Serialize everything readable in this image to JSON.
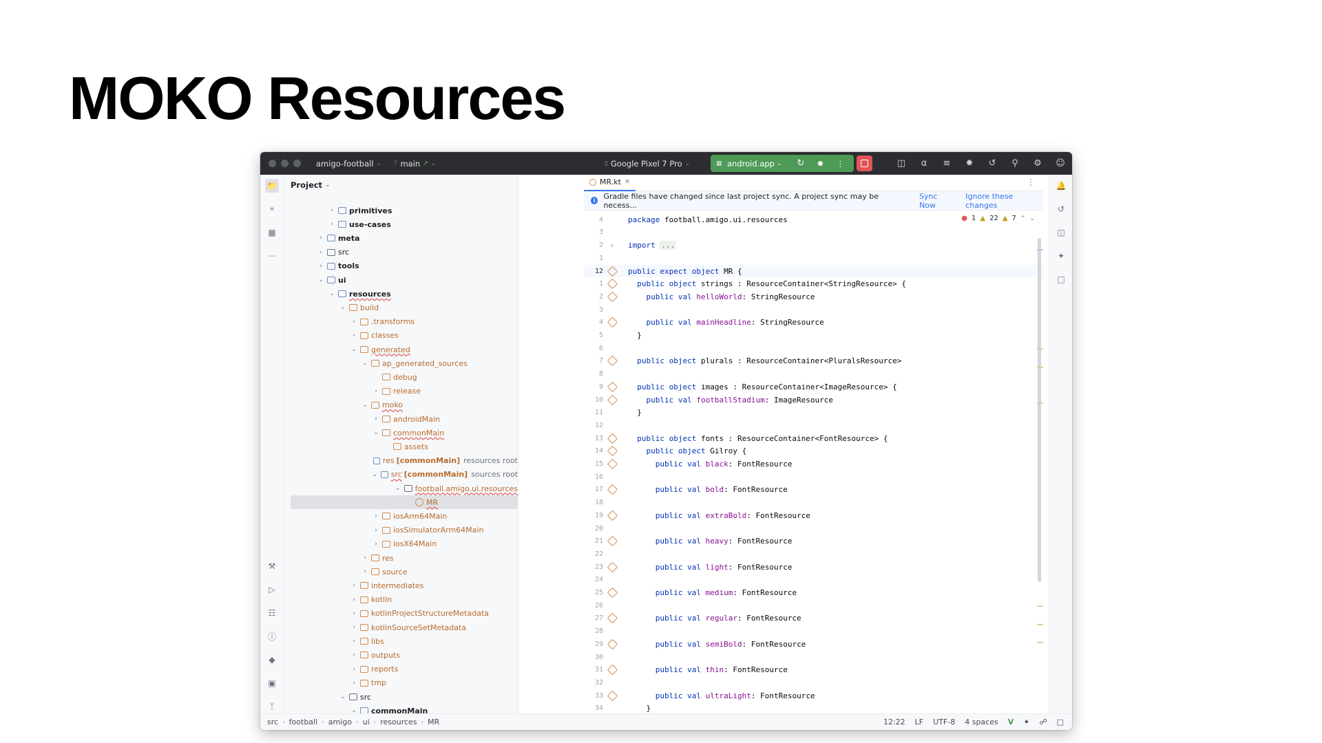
{
  "slide": {
    "title": "MOKO Resources"
  },
  "titlebar": {
    "project": "amigo-football",
    "branch": "main",
    "device": "Google Pixel 7 Pro",
    "run_config": "android.app"
  },
  "project_panel": {
    "title": "Project",
    "rows": [
      {
        "label": "primitives",
        "indent": 4,
        "chev": ">",
        "bold": true,
        "style": "blue"
      },
      {
        "label": "use-cases",
        "indent": 4,
        "chev": ">",
        "bold": true,
        "style": "blue"
      },
      {
        "label": "meta",
        "indent": 3,
        "chev": ">",
        "bold": true,
        "style": "blue"
      },
      {
        "label": "src",
        "indent": 3,
        "chev": ">",
        "bold": false,
        "style": "plain"
      },
      {
        "label": "tools",
        "indent": 3,
        "chev": ">",
        "bold": true,
        "style": "blue"
      },
      {
        "label": "ui",
        "indent": 3,
        "chev": "v",
        "bold": true,
        "style": "blue"
      },
      {
        "label": "resources",
        "indent": 4,
        "chev": "v",
        "bold": true,
        "style": "blue",
        "underline": true
      },
      {
        "label": "build",
        "indent": 5,
        "chev": "v",
        "style": "orange",
        "orangeText": true
      },
      {
        "label": ".transforms",
        "indent": 6,
        "chev": ">",
        "style": "orange",
        "orangeText": true
      },
      {
        "label": "classes",
        "indent": 6,
        "chev": ">",
        "style": "orange",
        "orangeText": true
      },
      {
        "label": "generated",
        "indent": 6,
        "chev": "v",
        "style": "orange",
        "orangeText": true,
        "underline": true
      },
      {
        "label": "ap_generated_sources",
        "indent": 7,
        "chev": "v",
        "style": "orange",
        "orangeText": true
      },
      {
        "label": "debug",
        "indent": 8,
        "chev": "",
        "style": "orange",
        "orangeText": true
      },
      {
        "label": "release",
        "indent": 8,
        "chev": ">",
        "style": "orange",
        "orangeText": true
      },
      {
        "label": "moko",
        "indent": 7,
        "chev": "v",
        "style": "orange",
        "orangeText": true,
        "underline": true
      },
      {
        "label": "androidMain",
        "indent": 8,
        "chev": ">",
        "style": "orange",
        "orangeText": true
      },
      {
        "label": "commonMain",
        "indent": 8,
        "chev": "v",
        "style": "orange",
        "orangeText": true,
        "underline": true
      },
      {
        "label": "assets",
        "indent": 9,
        "chev": "",
        "style": "orange",
        "orangeText": true
      },
      {
        "label": "res",
        "indent": 9,
        "chev": "",
        "style": "blue",
        "orangeText": true,
        "bracket": "[commonMain]",
        "suffix": "resources root"
      },
      {
        "label": "src",
        "indent": 9,
        "chev": "v",
        "style": "blue",
        "orangeText": true,
        "underline": true,
        "bracket": "[commonMain]",
        "suffix": "sources root"
      },
      {
        "label": "football.amigo.ui.resources",
        "indent": 10,
        "chev": "v",
        "style": "plain",
        "orangeText": true,
        "underline": true
      },
      {
        "label": "MR",
        "indent": 11,
        "chev": "",
        "style": "kotlin",
        "orangeText": true,
        "underline": true,
        "selected": true
      },
      {
        "label": "iosArm64Main",
        "indent": 8,
        "chev": ">",
        "style": "orange",
        "orangeText": true
      },
      {
        "label": "iosSimulatorArm64Main",
        "indent": 8,
        "chev": ">",
        "style": "orange",
        "orangeText": true
      },
      {
        "label": "iosX64Main",
        "indent": 8,
        "chev": ">",
        "style": "orange",
        "orangeText": true
      },
      {
        "label": "res",
        "indent": 7,
        "chev": ">",
        "style": "orange",
        "orangeText": true
      },
      {
        "label": "source",
        "indent": 7,
        "chev": ">",
        "style": "orange",
        "orangeText": true
      },
      {
        "label": "intermediates",
        "indent": 6,
        "chev": ">",
        "style": "orange",
        "orangeText": true
      },
      {
        "label": "kotlin",
        "indent": 6,
        "chev": ">",
        "style": "orange",
        "orangeText": true
      },
      {
        "label": "kotlinProjectStructureMetadata",
        "indent": 6,
        "chev": ">",
        "style": "orange",
        "orangeText": true
      },
      {
        "label": "kotlinSourceSetMetadata",
        "indent": 6,
        "chev": ">",
        "style": "orange",
        "orangeText": true
      },
      {
        "label": "libs",
        "indent": 6,
        "chev": ">",
        "style": "orange",
        "orangeText": true
      },
      {
        "label": "outputs",
        "indent": 6,
        "chev": ">",
        "style": "orange",
        "orangeText": true
      },
      {
        "label": "reports",
        "indent": 6,
        "chev": ">",
        "style": "orange",
        "orangeText": true
      },
      {
        "label": "tmp",
        "indent": 6,
        "chev": ">",
        "style": "orange",
        "orangeText": true
      },
      {
        "label": "src",
        "indent": 5,
        "chev": "v",
        "style": "plain"
      },
      {
        "label": "commonMain",
        "indent": 6,
        "chev": "v",
        "bold": true,
        "style": "blue"
      }
    ]
  },
  "editor": {
    "tab": "MR.kt",
    "notification": {
      "text": "Gradle files have changed since last project sync. A project sync may be necess...",
      "sync": "Sync Now",
      "ignore": "Ignore these changes"
    },
    "inspections": {
      "errors": "1",
      "warnings": "22",
      "weak": "7"
    },
    "lines": [
      {
        "n": "4",
        "icon": false,
        "parts": [
          [
            "kw",
            "package "
          ],
          [
            "t",
            "football.amigo.ui.resources"
          ]
        ]
      },
      {
        "n": "3",
        "icon": false,
        "parts": []
      },
      {
        "n": "2",
        "icon": false,
        "fold": true,
        "parts": [
          [
            "kw",
            "import "
          ],
          [
            "c",
            "..."
          ]
        ]
      },
      {
        "n": "1",
        "icon": false,
        "parts": []
      },
      {
        "n": "12",
        "icon": true,
        "current": true,
        "parts": [
          [
            "kw",
            "public expect object "
          ],
          [
            "t",
            "MR {"
          ]
        ]
      },
      {
        "n": "1",
        "icon": true,
        "parts": [
          [
            "t",
            "  "
          ],
          [
            "kw",
            "public object "
          ],
          [
            "t",
            "strings : ResourceContainer<StringResource> {"
          ]
        ]
      },
      {
        "n": "2",
        "icon": true,
        "parts": [
          [
            "t",
            "    "
          ],
          [
            "kw",
            "public val "
          ],
          [
            "fn",
            "helloWorld"
          ],
          [
            "t",
            ": StringResource"
          ]
        ]
      },
      {
        "n": "3",
        "icon": false,
        "parts": []
      },
      {
        "n": "4",
        "icon": true,
        "parts": [
          [
            "t",
            "    "
          ],
          [
            "kw",
            "public val "
          ],
          [
            "fn",
            "mainHeadline"
          ],
          [
            "t",
            ": StringResource"
          ]
        ]
      },
      {
        "n": "5",
        "icon": false,
        "parts": [
          [
            "t",
            "  }"
          ]
        ]
      },
      {
        "n": "6",
        "icon": false,
        "parts": []
      },
      {
        "n": "7",
        "icon": true,
        "parts": [
          [
            "t",
            "  "
          ],
          [
            "kw",
            "public object "
          ],
          [
            "t",
            "plurals : ResourceContainer<PluralsResource>"
          ]
        ]
      },
      {
        "n": "8",
        "icon": false,
        "parts": []
      },
      {
        "n": "9",
        "icon": true,
        "parts": [
          [
            "t",
            "  "
          ],
          [
            "kw",
            "public object "
          ],
          [
            "t",
            "images : ResourceContainer<ImageResource> {"
          ]
        ]
      },
      {
        "n": "10",
        "icon": true,
        "parts": [
          [
            "t",
            "    "
          ],
          [
            "kw",
            "public val "
          ],
          [
            "fn",
            "footballStadium"
          ],
          [
            "t",
            ": ImageResource"
          ]
        ]
      },
      {
        "n": "11",
        "icon": false,
        "parts": [
          [
            "t",
            "  }"
          ]
        ]
      },
      {
        "n": "12",
        "icon": false,
        "parts": []
      },
      {
        "n": "13",
        "icon": true,
        "parts": [
          [
            "t",
            "  "
          ],
          [
            "kw",
            "public object "
          ],
          [
            "t",
            "fonts : ResourceContainer<FontResource> {"
          ]
        ]
      },
      {
        "n": "14",
        "icon": true,
        "parts": [
          [
            "t",
            "    "
          ],
          [
            "kw",
            "public object "
          ],
          [
            "t",
            "Gilroy {"
          ]
        ]
      },
      {
        "n": "15",
        "icon": true,
        "parts": [
          [
            "t",
            "      "
          ],
          [
            "kw",
            "public val "
          ],
          [
            "fn",
            "black"
          ],
          [
            "t",
            ": FontResource"
          ]
        ]
      },
      {
        "n": "16",
        "icon": false,
        "parts": []
      },
      {
        "n": "17",
        "icon": true,
        "parts": [
          [
            "t",
            "      "
          ],
          [
            "kw",
            "public val "
          ],
          [
            "fn",
            "bold"
          ],
          [
            "t",
            ": FontResource"
          ]
        ]
      },
      {
        "n": "18",
        "icon": false,
        "parts": []
      },
      {
        "n": "19",
        "icon": true,
        "parts": [
          [
            "t",
            "      "
          ],
          [
            "kw",
            "public val "
          ],
          [
            "fn",
            "extraBold"
          ],
          [
            "t",
            ": FontResource"
          ]
        ]
      },
      {
        "n": "20",
        "icon": false,
        "parts": []
      },
      {
        "n": "21",
        "icon": true,
        "parts": [
          [
            "t",
            "      "
          ],
          [
            "kw",
            "public val "
          ],
          [
            "fn",
            "heavy"
          ],
          [
            "t",
            ": FontResource"
          ]
        ]
      },
      {
        "n": "22",
        "icon": false,
        "parts": []
      },
      {
        "n": "23",
        "icon": true,
        "parts": [
          [
            "t",
            "      "
          ],
          [
            "kw",
            "public val "
          ],
          [
            "fn",
            "light"
          ],
          [
            "t",
            ": FontResource"
          ]
        ]
      },
      {
        "n": "24",
        "icon": false,
        "parts": []
      },
      {
        "n": "25",
        "icon": true,
        "parts": [
          [
            "t",
            "      "
          ],
          [
            "kw",
            "public val "
          ],
          [
            "fn",
            "medium"
          ],
          [
            "t",
            ": FontResource"
          ]
        ]
      },
      {
        "n": "26",
        "icon": false,
        "parts": []
      },
      {
        "n": "27",
        "icon": true,
        "parts": [
          [
            "t",
            "      "
          ],
          [
            "kw",
            "public val "
          ],
          [
            "fn",
            "regular"
          ],
          [
            "t",
            ": FontResource"
          ]
        ]
      },
      {
        "n": "28",
        "icon": false,
        "parts": []
      },
      {
        "n": "29",
        "icon": true,
        "parts": [
          [
            "t",
            "      "
          ],
          [
            "kw",
            "public val "
          ],
          [
            "fn",
            "semiBold"
          ],
          [
            "t",
            ": FontResource"
          ]
        ]
      },
      {
        "n": "30",
        "icon": false,
        "parts": []
      },
      {
        "n": "31",
        "icon": true,
        "parts": [
          [
            "t",
            "      "
          ],
          [
            "kw",
            "public val "
          ],
          [
            "fn",
            "thin"
          ],
          [
            "t",
            ": FontResource"
          ]
        ]
      },
      {
        "n": "32",
        "icon": false,
        "parts": []
      },
      {
        "n": "33",
        "icon": true,
        "parts": [
          [
            "t",
            "      "
          ],
          [
            "kw",
            "public val "
          ],
          [
            "fn",
            "ultraLight"
          ],
          [
            "t",
            ": FontResource"
          ]
        ]
      },
      {
        "n": "34",
        "icon": false,
        "parts": [
          [
            "t",
            "    }"
          ]
        ]
      }
    ]
  },
  "statusbar": {
    "breadcrumbs": [
      "src",
      "football",
      "amigo",
      "ui",
      "resources",
      "MR"
    ],
    "position": "12:22",
    "line_sep": "LF",
    "encoding": "UTF-8",
    "indent": "4 spaces"
  },
  "colors": {
    "run_green": "#4e9a57",
    "stop_red": "#e05555",
    "accent_blue": "#3574f0",
    "folder_orange": "#d18a4b"
  }
}
